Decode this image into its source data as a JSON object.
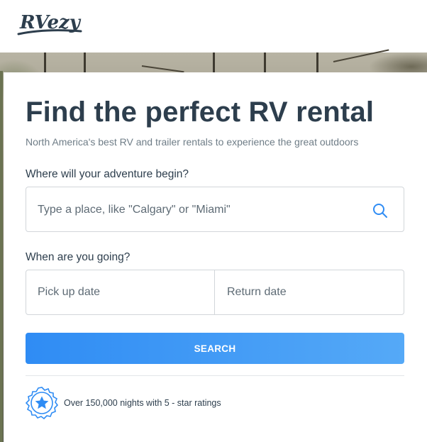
{
  "header": {
    "logo_text": "RVezy"
  },
  "hero": {
    "title": "Find the perfect RV rental",
    "subtitle": "North America's best RV and trailer rentals to experience the great outdoors"
  },
  "location": {
    "label": "Where will your adventure begin?",
    "placeholder": "Type a place, like \"Calgary\" or \"Miami\"",
    "icon": "search-icon"
  },
  "dates": {
    "label": "When are you going?",
    "pickup_placeholder": "Pick up date",
    "return_placeholder": "Return date"
  },
  "search_button": {
    "label": "SEARCH"
  },
  "rating": {
    "icon": "star-badge-icon",
    "text": "Over 150,000 nights with 5 - star ratings"
  },
  "colors": {
    "primary_text": "#2d3e4d",
    "muted_text": "#6f7d87",
    "button_start": "#2f8cf4",
    "button_end": "#55a9f7",
    "accent_blue": "#2f8cf4"
  }
}
